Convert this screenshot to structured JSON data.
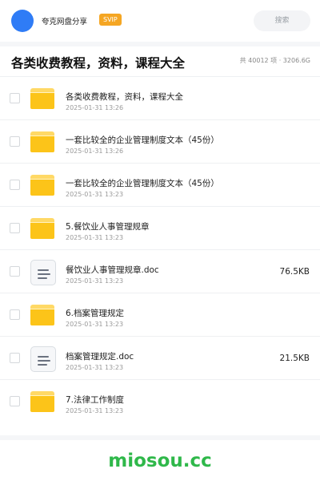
{
  "header": {
    "app_title": "夸克网盘分享",
    "badge": "SVIP",
    "search_placeholder": "搜索"
  },
  "page": {
    "title": "各类收费教程，资料，课程大全",
    "summary": "共 40012 项 · 3206.6G"
  },
  "files": [
    {
      "type": "folder",
      "name": "各类收费教程，资料，课程大全",
      "date": "2025-01-31 13:26",
      "size": ""
    },
    {
      "type": "folder",
      "name": "一套比较全的企业管理制度文本（45份）",
      "date": "2025-01-31 13:26",
      "size": ""
    },
    {
      "type": "folder",
      "name": "一套比较全的企业管理制度文本（45份）",
      "date": "2025-01-31 13:23",
      "size": ""
    },
    {
      "type": "folder",
      "name": "5.餐饮业人事管理规章",
      "date": "2025-01-31 13:23",
      "size": ""
    },
    {
      "type": "doc",
      "name": "餐饮业人事管理规章.doc",
      "date": "2025-01-31 13:23",
      "size": "76.5KB"
    },
    {
      "type": "folder",
      "name": "6.档案管理规定",
      "date": "2025-01-31 13:23",
      "size": ""
    },
    {
      "type": "doc",
      "name": "档案管理规定.doc",
      "date": "2025-01-31 13:23",
      "size": "21.5KB"
    },
    {
      "type": "folder",
      "name": "7.法律工作制度",
      "date": "2025-01-31 13:23",
      "size": ""
    }
  ],
  "watermark": "miosou.cc",
  "colors": {
    "avatar": "#2f7cf6",
    "badge": "#f5a623",
    "folder": "#fcc419",
    "watermark": "#2fb84a"
  }
}
